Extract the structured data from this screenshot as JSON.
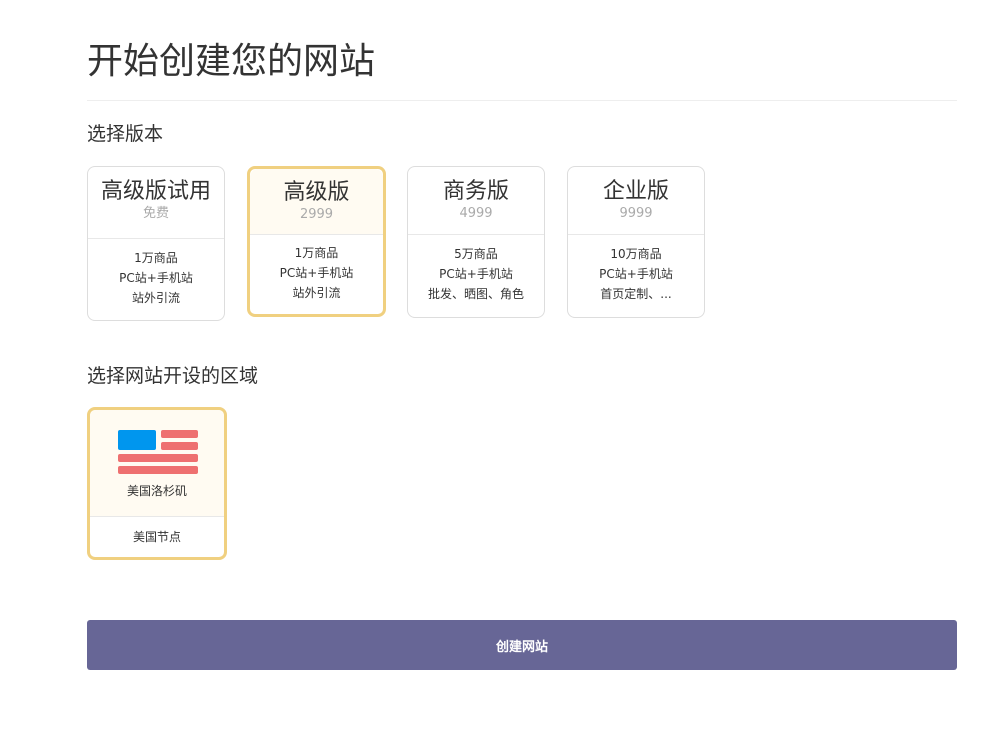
{
  "header": {
    "title": "开始创建您的网站"
  },
  "version_section": {
    "title": "选择版本",
    "plans": [
      {
        "name": "高级版试用",
        "price": "免费",
        "features": [
          "1万商品",
          "PC站+手机站",
          "站外引流"
        ],
        "selected": false
      },
      {
        "name": "高级版",
        "price": "2999",
        "features": [
          "1万商品",
          "PC站+手机站",
          "站外引流"
        ],
        "selected": true
      },
      {
        "name": "商务版",
        "price": "4999",
        "features": [
          "5万商品",
          "PC站+手机站",
          "批发、晒图、角色"
        ],
        "selected": false
      },
      {
        "name": "企业版",
        "price": "9999",
        "features": [
          "10万商品",
          "PC站+手机站",
          "首页定制、..."
        ],
        "selected": false
      }
    ]
  },
  "region_section": {
    "title": "选择网站开设的区域",
    "regions": [
      {
        "city": "美国洛杉矶",
        "node": "美国节点",
        "flag_icon": "us-flag-icon",
        "selected": true
      }
    ]
  },
  "actions": {
    "create_label": "创建网站"
  },
  "colors": {
    "accent_button": "#676696",
    "selected_border": "#f0d080",
    "flag_blue": "#0096ee",
    "flag_red": "#ee7070"
  }
}
